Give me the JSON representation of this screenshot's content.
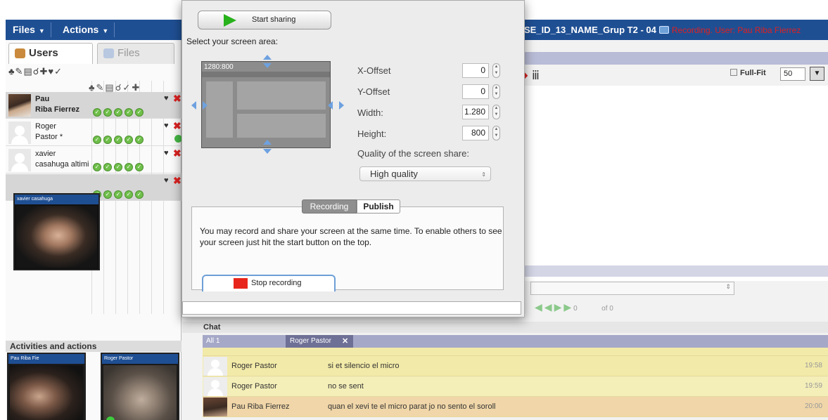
{
  "topbar": {
    "menus": [
      {
        "label": "Files"
      },
      {
        "label": "Actions"
      }
    ],
    "room_title": "SE_ID_13_NAME_Grup T2 - 04",
    "recording_status": "Recording. User:  Pau Riba Fierrez"
  },
  "left_panel": {
    "tabs": [
      {
        "label": "Users"
      },
      {
        "label": "Files"
      }
    ],
    "users": [
      {
        "first": "Pau",
        "second": "Riba Fierrez",
        "selected": true
      },
      {
        "first": "Roger",
        "second": "Pastor *"
      },
      {
        "first": "xavier",
        "second": "casahuga altimi"
      },
      {
        "first": "",
        "second": ""
      }
    ],
    "webcam_label": "xavier casahuga",
    "activities_title": "Activities and actions",
    "activity_cams": [
      {
        "label": "Pau Riba Fie"
      },
      {
        "label": "Roger Pastor"
      }
    ]
  },
  "whiteboard": {
    "full_fit_label": "Full-Fit",
    "zoom_value": "50",
    "page_current": "0",
    "page_total": "of 0"
  },
  "chat": {
    "title": "Chat",
    "tabs": {
      "all": "All 1",
      "private": "Roger Pastor",
      "close": "✕"
    },
    "messages": [
      {
        "user": "Roger Pastor",
        "text": "si et silencio el micro",
        "time": "19:58"
      },
      {
        "user": "Roger Pastor",
        "text": "no se sent",
        "time": "19:59"
      },
      {
        "user": "Pau Riba Fierrez",
        "text": "quan el xevi te el micro parat jo no sento el soroll",
        "time": "20:00"
      }
    ]
  },
  "dialog": {
    "start_label": "Start sharing",
    "area_label": "Select your screen area:",
    "preview_label": "1280:800",
    "fields": [
      {
        "label": "X-Offset",
        "value": "0"
      },
      {
        "label": "Y-Offset",
        "value": "0"
      },
      {
        "label": "Width:",
        "value": "1.280"
      },
      {
        "label": "Height:",
        "value": "800"
      }
    ],
    "quality_label": "Quality of the screen share:",
    "quality_value": "High quality",
    "tab_recording": "Recording",
    "tab_publish": "Publish",
    "info_text": "You may record and share your screen at the same time. To enable others to see your screen just hit the start button on the top.",
    "stop_label": "Stop recording"
  },
  "colors": {
    "topbar": "#1f4f93",
    "recording": "#e02020",
    "chat_row": "#f2eaa8",
    "chat_row_own": "#f0d6a8",
    "start_play": "#27b11b",
    "stop_square": "#e8251c"
  }
}
